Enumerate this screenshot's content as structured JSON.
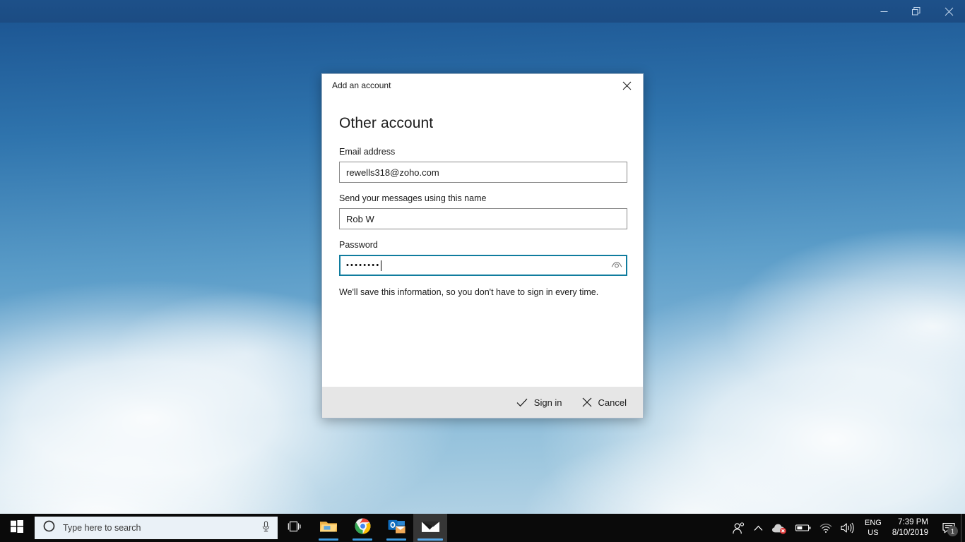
{
  "window": {
    "minimize_icon": "minimize-icon",
    "restore_icon": "restore-icon",
    "close_icon": "close-icon"
  },
  "dialog": {
    "title": "Add an account",
    "close_icon": "close-icon",
    "heading": "Other account",
    "fields": [
      {
        "label": "Email address",
        "value": "rewells318@zoho.com",
        "focused": false
      },
      {
        "label": "Send your messages using this name",
        "value": "Rob W",
        "focused": false
      }
    ],
    "password": {
      "label": "Password",
      "masked_value": "••••••••",
      "char_count": 8,
      "focused": true,
      "reveal_icon": "eye-icon"
    },
    "help_text": "We'll save this information, so you don't have to sign in every time.",
    "footer": {
      "primary_label": "Sign in",
      "primary_icon": "check-icon",
      "secondary_label": "Cancel",
      "secondary_icon": "close-icon"
    },
    "accent_color": "#107c9e",
    "footer_background": "#e6e6e6"
  },
  "taskbar": {
    "start_icon": "windows-logo-icon",
    "search": {
      "placeholder": "Type here to search",
      "cortana_icon": "cortana-circle-icon",
      "mic_icon": "microphone-icon"
    },
    "items": [
      {
        "name": "task-view",
        "icon": "task-view-icon",
        "running": false
      },
      {
        "name": "file-explorer",
        "icon": "folder-icon",
        "running": true
      },
      {
        "name": "google-chrome",
        "icon": "chrome-icon",
        "running": true
      },
      {
        "name": "outlook",
        "icon": "outlook-icon",
        "running": true
      },
      {
        "name": "mail",
        "icon": "mail-envelope-icon",
        "running": true,
        "active": true
      }
    ],
    "tray": {
      "people_icon": "people-icon",
      "chevron_icon": "chevron-up-icon",
      "onedrive_icon": "onedrive-error-icon",
      "battery_icon": "battery-icon",
      "network_icon": "wifi-icon",
      "volume_icon": "speaker-icon",
      "language_line1": "ENG",
      "language_line2": "US",
      "time": "7:39 PM",
      "date": "8/10/2019",
      "notification_icon": "notification-icon",
      "notification_count": "1"
    }
  },
  "desktop": {
    "wallpaper_description": "blue-sky-with-clouds"
  }
}
